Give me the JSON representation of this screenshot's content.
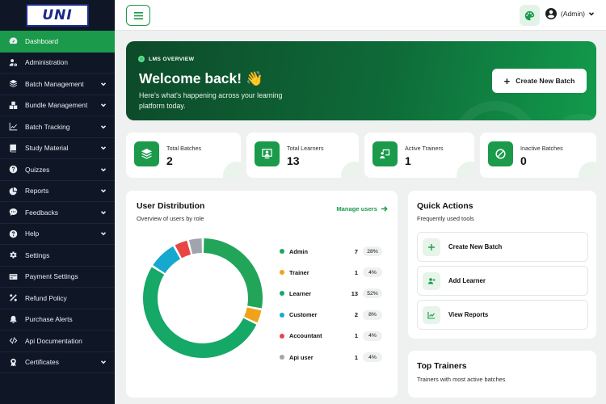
{
  "brand": {
    "logo_text": "UNI"
  },
  "sidebar": {
    "items": [
      {
        "label": "Dashboard",
        "icon": "speedometer-icon",
        "active": true,
        "has_submenu": false
      },
      {
        "label": "Administration",
        "icon": "user-gear-icon",
        "active": false,
        "has_submenu": false
      },
      {
        "label": "Batch Management",
        "icon": "layers-icon",
        "active": false,
        "has_submenu": true
      },
      {
        "label": "Bundle Management",
        "icon": "boxes-icon",
        "active": false,
        "has_submenu": true
      },
      {
        "label": "Batch Tracking",
        "icon": "line-chart-icon",
        "active": false,
        "has_submenu": true
      },
      {
        "label": "Study Material",
        "icon": "book-icon",
        "active": false,
        "has_submenu": true
      },
      {
        "label": "Quizzes",
        "icon": "question-circle-icon",
        "active": false,
        "has_submenu": true
      },
      {
        "label": "Reports",
        "icon": "pie-chart-icon",
        "active": false,
        "has_submenu": true
      },
      {
        "label": "Feedbacks",
        "icon": "chat-icon",
        "active": false,
        "has_submenu": true
      },
      {
        "label": "Help",
        "icon": "help-circle-icon",
        "active": false,
        "has_submenu": true
      },
      {
        "label": "Settings",
        "icon": "gear-icon",
        "active": false,
        "has_submenu": false
      },
      {
        "label": "Payment Settings",
        "icon": "credit-card-icon",
        "active": false,
        "has_submenu": false
      },
      {
        "label": "Refund Policy",
        "icon": "percent-icon",
        "active": false,
        "has_submenu": false
      },
      {
        "label": "Purchase Alerts",
        "icon": "bell-icon",
        "active": false,
        "has_submenu": false
      },
      {
        "label": "Api Documentation",
        "icon": "code-icon",
        "active": false,
        "has_submenu": false
      },
      {
        "label": "Certificates",
        "icon": "award-icon",
        "active": false,
        "has_submenu": true
      }
    ]
  },
  "topbar": {
    "user_label": "(Admin)"
  },
  "hero": {
    "badge": "LMS OVERVIEW",
    "title": "Welcome back! 👋",
    "subtitle": "Here's what's happening across your learning platform today.",
    "button_label": "Create New Batch"
  },
  "stats": [
    {
      "label": "Total Batches",
      "value": "2",
      "icon": "layers-icon"
    },
    {
      "label": "Total Learners",
      "value": "13",
      "icon": "learner-icon"
    },
    {
      "label": "Active Trainers",
      "value": "1",
      "icon": "trainer-icon"
    },
    {
      "label": "Inactive Batches",
      "value": "0",
      "icon": "ban-icon"
    }
  ],
  "distribution": {
    "title": "User Distribution",
    "subtitle": "Overview of users by role",
    "link_label": "Manage users"
  },
  "chart_data": {
    "type": "pie",
    "categories": [
      "Admin",
      "Trainer",
      "Learner",
      "Customer",
      "Accountant",
      "Api user"
    ],
    "values": [
      7,
      1,
      13,
      2,
      1,
      1
    ],
    "percent_labels": [
      "28%",
      "4%",
      "52%",
      "8%",
      "4%",
      "4%"
    ],
    "colors": [
      "#22a559",
      "#f0a21a",
      "#16a866",
      "#15a9cf",
      "#e84545",
      "#a0a4ad"
    ],
    "title": "",
    "legend_position": "right"
  },
  "quick_actions": {
    "title": "Quick Actions",
    "subtitle": "Frequently used tools",
    "items": [
      {
        "label": "Create New Batch",
        "icon": "plus-icon"
      },
      {
        "label": "Add Learner",
        "icon": "user-plus-icon"
      },
      {
        "label": "View Reports",
        "icon": "line-chart-icon"
      }
    ]
  },
  "top_trainers": {
    "title": "Top Trainers",
    "subtitle": "Trainers with most active batches"
  }
}
